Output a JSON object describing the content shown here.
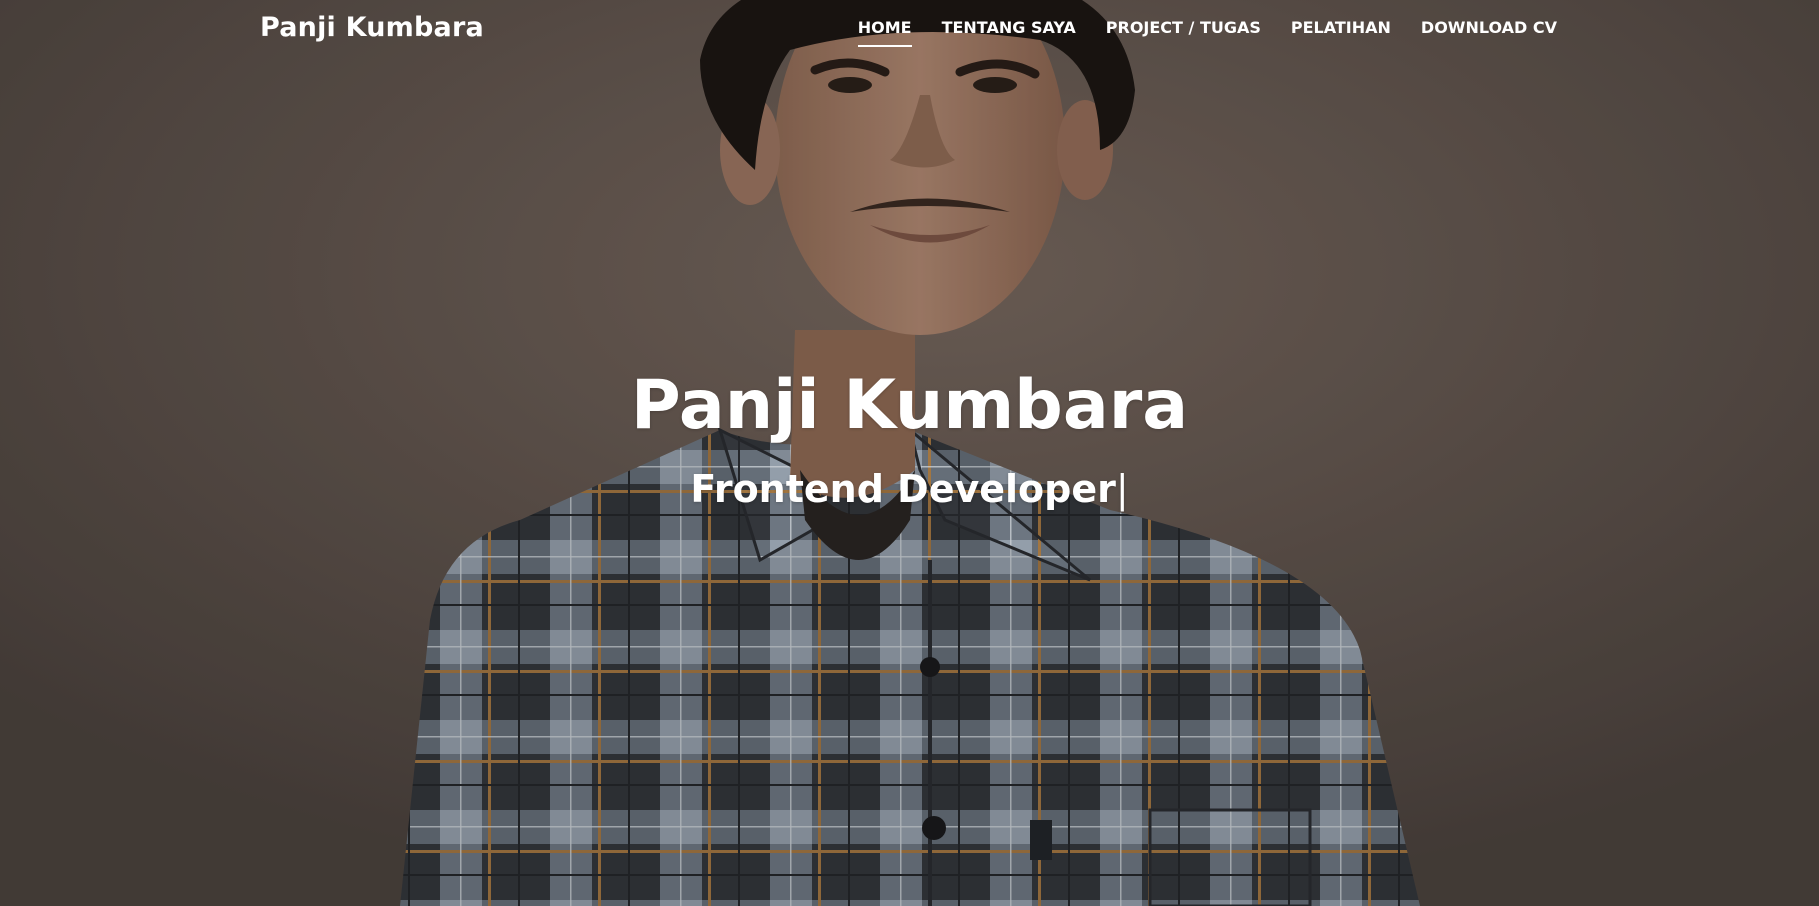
{
  "navbar": {
    "brand": "Panji Kumbara",
    "items": [
      {
        "label": "HOME",
        "active": true
      },
      {
        "label": "TENTANG SAYA",
        "active": false
      },
      {
        "label": "PROJECT / TUGAS",
        "active": false
      },
      {
        "label": "PELATIHAN",
        "active": false
      },
      {
        "label": "DOWNLOAD CV",
        "active": false
      }
    ]
  },
  "hero": {
    "title": "Panji Kumbara",
    "subtitle": "Frontend Developer",
    "cursor": "|"
  },
  "colors": {
    "background": "#5e524b",
    "text": "#ffffff",
    "shirt_dark": "#3b3d42",
    "shirt_light": "#9aa7b4",
    "shirt_stripe": "#b9874a",
    "skin": "#a9826a",
    "hair": "#1c1613"
  },
  "icons": {
    "hero_photo": "portrait-photo"
  }
}
